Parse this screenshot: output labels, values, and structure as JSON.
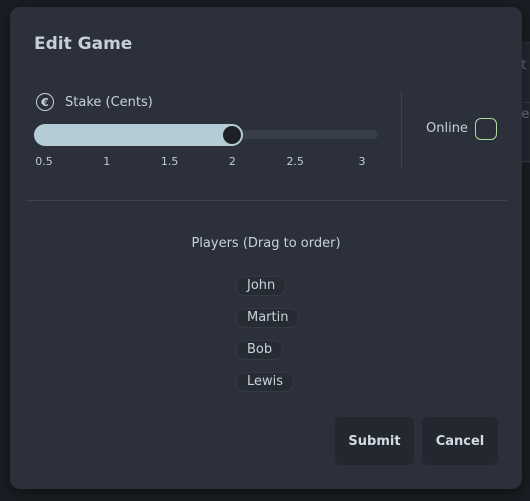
{
  "background": {
    "fragments": [
      "nt",
      "ue"
    ]
  },
  "modal": {
    "title": "Edit Game",
    "stake": {
      "icon": "euro-icon",
      "icon_glyph": "€",
      "label": "Stake (Cents)",
      "min": 0.5,
      "max": 3,
      "value": 2,
      "ticks": [
        "0.5",
        "1",
        "1.5",
        "2",
        "2.5",
        "3"
      ]
    },
    "online": {
      "label": "Online",
      "checked": false
    },
    "players": {
      "title": "Players (Drag to order)",
      "items": [
        "John",
        "Martin",
        "Bob",
        "Lewis"
      ]
    },
    "actions": {
      "submit_label": "Submit",
      "cancel_label": "Cancel"
    }
  },
  "colors": {
    "accent": "#b5ccd6",
    "toggle_border": "#a9dba1",
    "modal_bg": "#2b303a"
  }
}
